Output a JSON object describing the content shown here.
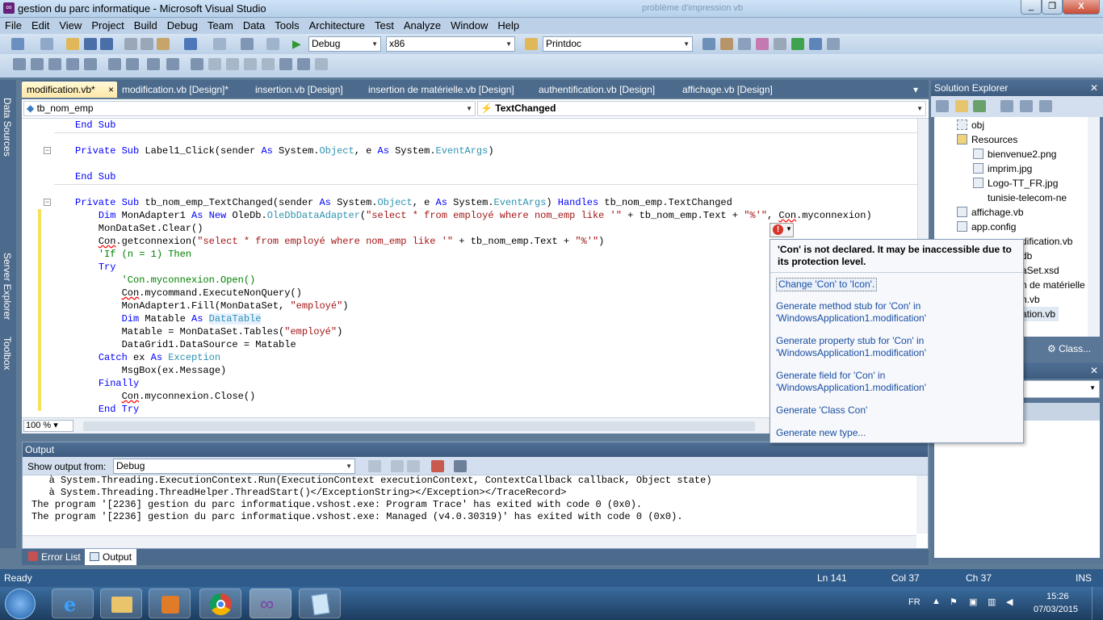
{
  "window": {
    "title": "gestion du parc informatique - Microsoft Visual Studio",
    "ghost_tab": "problème d'impression vb",
    "buttons": {
      "minimize": "_",
      "maximize": "❐",
      "close": "X"
    }
  },
  "menu": [
    "File",
    "Edit",
    "View",
    "Project",
    "Build",
    "Debug",
    "Team",
    "Data",
    "Tools",
    "Architecture",
    "Test",
    "Analyze",
    "Window",
    "Help"
  ],
  "toolbar": {
    "config": "Debug",
    "platform": "x86",
    "find_combo": "Printdoc"
  },
  "side_tools": [
    "Data Sources",
    "Server Explorer",
    "Toolbox"
  ],
  "doc_tabs": [
    {
      "label": "modification.vb*",
      "active": true
    },
    {
      "label": "modification.vb [Design]*"
    },
    {
      "label": "insertion.vb [Design]"
    },
    {
      "label": "insertion de matérielle.vb [Design]"
    },
    {
      "label": "authentification.vb [Design]"
    },
    {
      "label": "affichage.vb [Design]"
    }
  ],
  "nav": {
    "object": "tb_nom_emp",
    "event": "TextChanged"
  },
  "zoom": "100 %",
  "output": {
    "title": "Output",
    "show_from_label": "Show output from:",
    "source": "Debug",
    "lines": [
      "   à System.Threading.ExecutionContext.Run(ExecutionContext executionContext, ContextCallback callback, Object state)",
      "   à System.Threading.ThreadHelper.ThreadStart()</ExceptionString></Exception></TraceRecord>",
      "The program '[2236] gestion du parc informatique.vshost.exe: Program Trace' has exited with code 0 (0x0).",
      "The program '[2236] gestion du parc informatique.vshost.exe: Managed (v4.0.30319)' has exited with code 0 (0x0)."
    ]
  },
  "bottom_tabs": [
    "Error List",
    "Output"
  ],
  "solution_explorer": {
    "title": "Solution Explorer",
    "items": [
      "obj",
      "Resources",
      "bienvenue2.png",
      "imprim.jpg",
      "Logo-TT_FR.jpg",
      "tunisie-telecom-ne",
      "affichage.vb",
      "app.config",
      "dification.vb",
      "db",
      "aSet.xsd",
      "n de matérielle",
      "n.vb",
      "ation.vb"
    ],
    "class_tab": "Class..."
  },
  "error_popup": {
    "message": "'Con' is not declared. It may be inaccessible due to its protection level.",
    "actions": [
      "Change 'Con' to 'Icon'.",
      "Generate method stub for 'Con' in 'WindowsApplication1.modification'",
      "Generate property stub for 'Con' in 'WindowsApplication1.modification'",
      "Generate field for 'Con' in 'WindowsApplication1.modification'",
      "Generate 'Class Con'",
      "Generate new type..."
    ]
  },
  "status": {
    "ready": "Ready",
    "ln": "Ln 141",
    "col": "Col 37",
    "ch": "Ch 37",
    "ins": "INS"
  },
  "taskbar": {
    "lang": "FR",
    "time": "15:26",
    "date": "07/03/2015"
  }
}
